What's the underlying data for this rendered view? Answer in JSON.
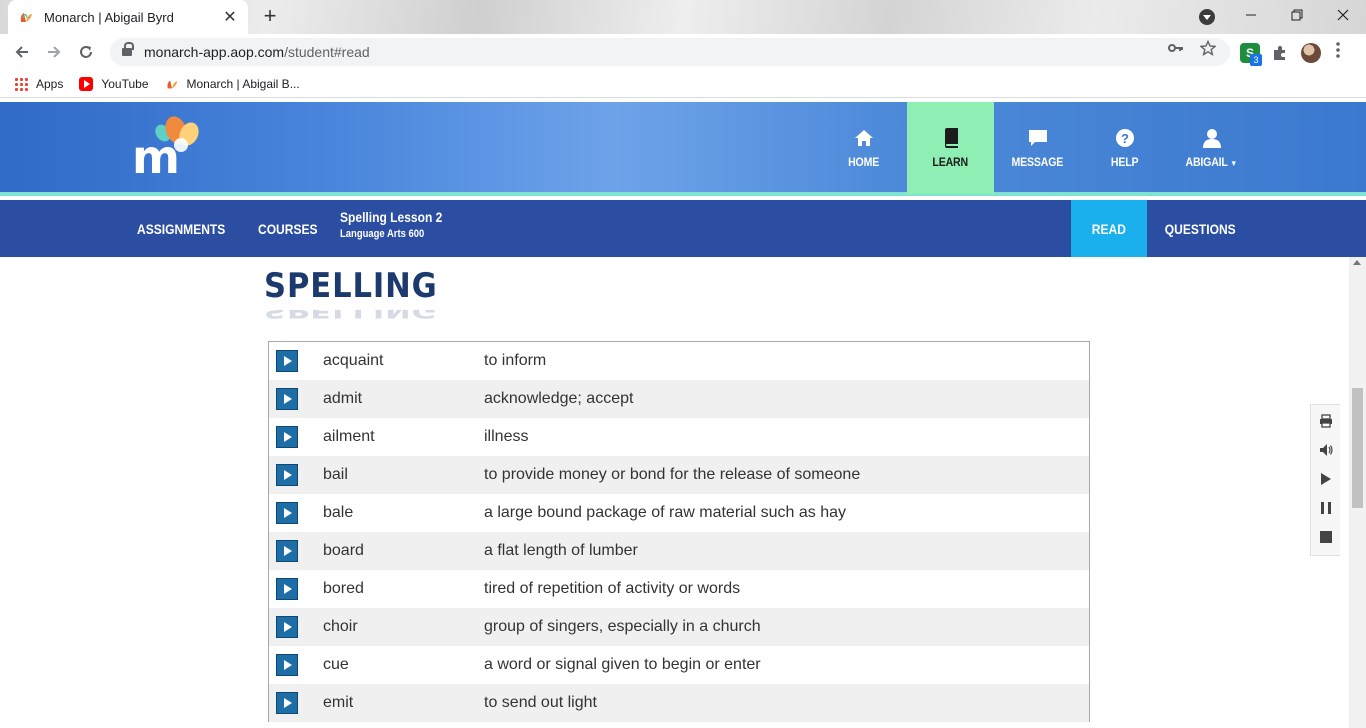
{
  "browser": {
    "tab_title": "Monarch | Abigail Byrd",
    "tab_close": "✕",
    "new_tab": "+",
    "url_host": "monarch-app.aop.com",
    "url_path": "/student#read",
    "extension_badge": "3",
    "extension_letter": "S",
    "bookmarks": [
      {
        "label": "Apps",
        "icon": "apps-grid-icon"
      },
      {
        "label": "YouTube",
        "icon": "youtube-icon"
      },
      {
        "label": "Monarch | Abigail B...",
        "icon": "monarch-icon"
      }
    ]
  },
  "header": {
    "nav": [
      {
        "label": "HOME",
        "icon": "home-icon"
      },
      {
        "label": "LEARN",
        "icon": "book-icon"
      },
      {
        "label": "MESSAGE",
        "icon": "chat-bubble-icon"
      },
      {
        "label": "HELP",
        "icon": "question-icon"
      },
      {
        "label": "ABIGAIL",
        "icon": "user-icon"
      }
    ]
  },
  "subnav": {
    "assignments": "ASSIGNMENTS",
    "courses": "COURSES",
    "lesson_title": "Spelling Lesson 2",
    "lesson_course": "Language Arts 600",
    "read": "READ",
    "questions": "QUESTIONS"
  },
  "content": {
    "heading": "SPELLING",
    "words": [
      {
        "word": "acquaint",
        "definition": "to inform"
      },
      {
        "word": "admit",
        "definition": "acknowledge; accept"
      },
      {
        "word": "ailment",
        "definition": "illness"
      },
      {
        "word": "bail",
        "definition": "to provide money or bond for the release of someone"
      },
      {
        "word": "bale",
        "definition": "a large bound package of raw material such as hay"
      },
      {
        "word": "board",
        "definition": "a flat length of lumber"
      },
      {
        "word": "bored",
        "definition": "tired of repetition of activity or words"
      },
      {
        "word": "choir",
        "definition": "group of singers, especially in a church"
      },
      {
        "word": "cue",
        "definition": "a word or signal given to begin or enter"
      },
      {
        "word": "emit",
        "definition": "to send out light"
      }
    ]
  },
  "colors": {
    "header_blue": "#3b79cf",
    "learn_active": "#8eeeb4",
    "subnav_blue": "#2b4ea3",
    "read_active": "#1ab0ee",
    "play_button": "#1d6ea6"
  }
}
